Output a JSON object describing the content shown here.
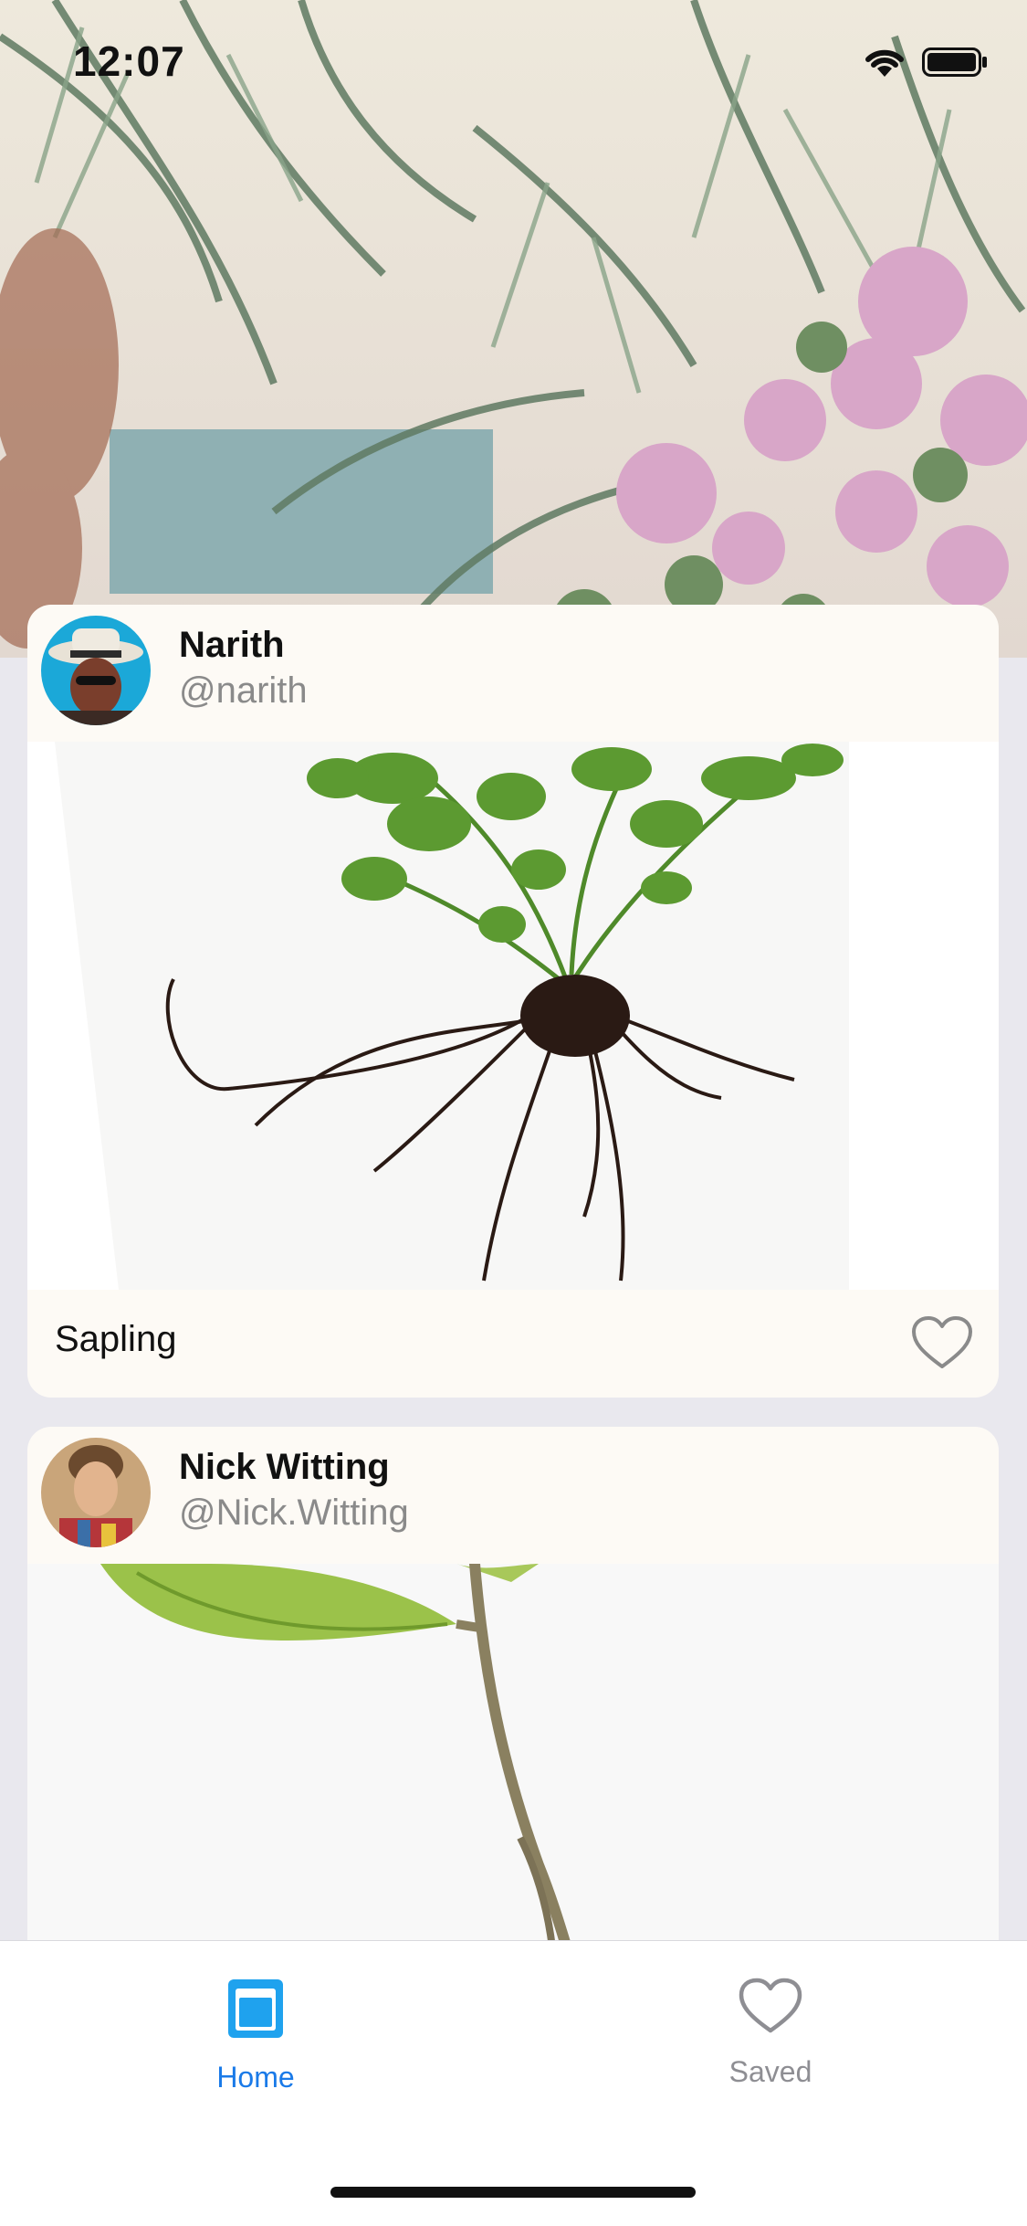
{
  "status_bar": {
    "time": "12:07"
  },
  "feed": [
    {
      "name": "Narith",
      "handle": "@narith",
      "caption": "Sapling",
      "liked": false
    },
    {
      "name": "Nick Witting",
      "handle": "@Nick.Witting",
      "caption": "",
      "liked": false
    }
  ],
  "tab_bar": {
    "tabs": [
      {
        "label": "Home",
        "icon": "home-tab-icon",
        "selected": true
      },
      {
        "label": "Saved",
        "icon": "heart-outline-icon",
        "selected": false
      }
    ]
  },
  "colors": {
    "accent": "#1a7ae8",
    "inactive": "#8e8e93",
    "card": "#fdfaf5",
    "background": "#e9e8ee"
  }
}
